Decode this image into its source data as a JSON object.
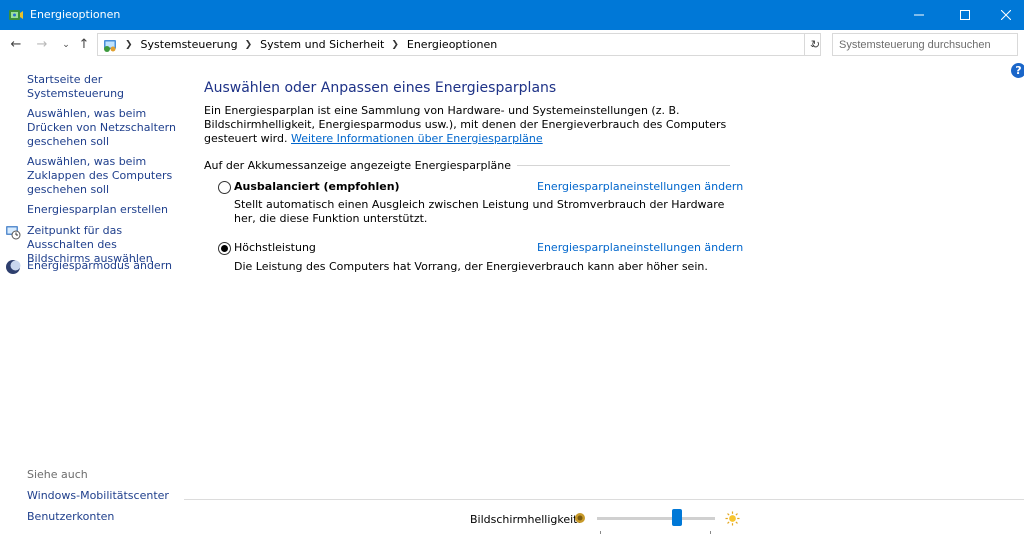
{
  "window": {
    "title": "Energieoptionen",
    "icon": "power-options-icon",
    "minimize_icon": "minimize-icon",
    "maximize_icon": "maximize-icon",
    "close_icon": "close-icon"
  },
  "nav": {
    "back_icon": "←",
    "forward_icon": "→",
    "recent_icon": "⌄",
    "up_icon": "↑",
    "breadcrumbs": [
      "Systemsteuerung",
      "System und Sicherheit",
      "Energieoptionen"
    ],
    "dropdown_icon": "⌄",
    "refresh_icon": "↻",
    "search_placeholder": "Systemsteuerung durchsuchen"
  },
  "sidebar": {
    "items": [
      "Startseite der Systemsteuerung",
      "Auswählen, was beim Drücken von Netzschaltern geschehen soll",
      "Auswählen, was beim Zuklappen des Computers geschehen soll",
      "Energiesparplan erstellen",
      "Zeitpunkt für das Ausschalten des Bildschirms auswählen",
      "Energiesparmodus ändern"
    ],
    "see_also_label": "Siehe auch",
    "see_also": [
      "Windows-Mobilitätscenter",
      "Benutzerkonten"
    ]
  },
  "help_icon": "?",
  "main": {
    "title": "Auswählen oder Anpassen eines Energiesparplans",
    "intro_text": "Ein Energiesparplan ist eine Sammlung von Hardware- und Systemeinstellungen (z. B. Bildschirmhelligkeit, Energiesparmodus usw.), mit denen der Energieverbrauch des Computers gesteuert wird. ",
    "intro_link": "Weitere Informationen über Energiesparpläne",
    "group_label": "Auf der Akkumessanzeige angezeigte Energiesparpläne",
    "plans": [
      {
        "name": "Ausbalanciert (empfohlen)",
        "selected": false,
        "settings_link": "Energiesparplaneinstellungen ändern",
        "description": "Stellt automatisch einen Ausgleich zwischen Leistung und Stromverbrauch der Hardware her, die diese Funktion unterstützt."
      },
      {
        "name": "Höchstleistung",
        "selected": true,
        "settings_link": "Energiesparplaneinstellungen ändern",
        "description": "Die Leistung des Computers hat Vorrang, der Energieverbrauch kann aber höher sein."
      }
    ]
  },
  "brightness": {
    "label": "Bildschirmhelligkeit:",
    "level_fraction": 0.68,
    "accent_color": "#0078d7"
  },
  "colors": {
    "titlebar": "#0078d7",
    "link": "#1f3f8c",
    "title_text": "#1e3287"
  }
}
